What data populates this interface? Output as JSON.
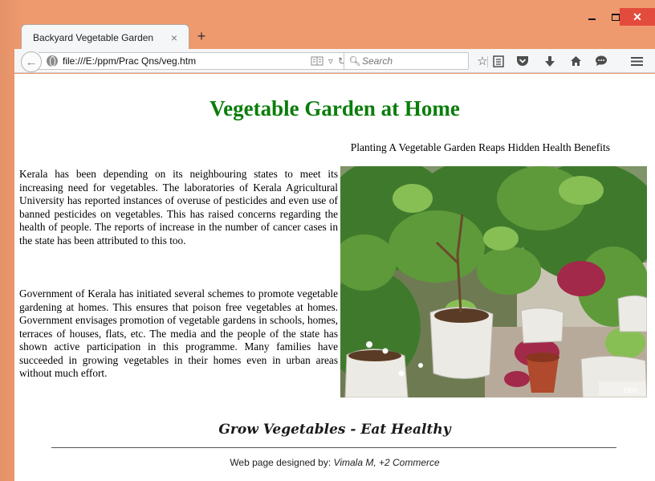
{
  "browser": {
    "tab_title": "Backyard Vegetable Garden",
    "tab_close_glyph": "×",
    "new_tab_glyph": "+",
    "url": "file:///E:/ppm/Prac Qns/veg.htm",
    "search_placeholder": "Search",
    "window_controls": [
      "minimize",
      "maximize",
      "close"
    ],
    "toolbar_icons": [
      "back-arrow-icon",
      "globe-icon",
      "reader-view-icon",
      "dropdown-icon",
      "reload-icon",
      "search-icon",
      "bookmark-star-icon",
      "reading-list-icon",
      "pocket-icon",
      "download-icon",
      "home-icon",
      "chat-icon",
      "menu-icon"
    ],
    "chrome_color": "#ef9a6e"
  },
  "page": {
    "heading": "Vegetable Garden at Home",
    "heading_color": "#0a7d0a",
    "subtitle": "Planting A Vegetable Garden Reaps Hidden Health Benefits",
    "paragraph1": "Kerala has been depending on its neighbouring states to meet its increasing need for vegetables. The laboratories of Kerala Agricultural University has reported instances of overuse of pesticides and even use of banned pesticides on vegetables. This has raised concerns regarding the health of people. The reports of increase in the number of cancer cases in the state has been attributed to this too.",
    "paragraph2": "Government of Kerala has initiated several schemes to promote vegetable gardening at homes. This ensures that poison free vegetables at homes. Government envisages promotion of vegetable gardens in schools, homes, terraces of houses, flats, etc. The media and the people of the state has shown active participation in this programme. Many families have succeeded in growing vegetables in their homes even in urban areas without much effort.",
    "image_watermark": "zen",
    "slogan": "Grow Vegetables - Eat Healthy",
    "credit_prefix": "Web page designed by:",
    "credit_name": "Vimala M, +2 Commerce"
  }
}
